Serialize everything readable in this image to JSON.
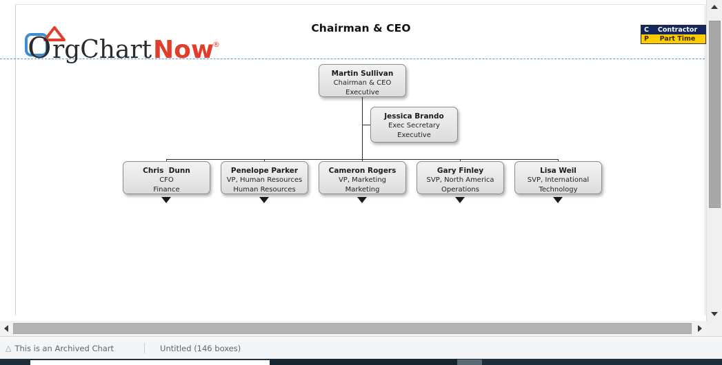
{
  "page_title": "Chairman & CEO",
  "logo": {
    "text_primary": "OrgChart",
    "text_secondary": "Now",
    "trademark": "®",
    "color_primary": "#2b2b2b",
    "color_secondary": "#e03e2d",
    "color_square": "#3f8ed0"
  },
  "legend": {
    "rows": [
      {
        "code": "C",
        "label": "Contractor",
        "bg": "#14265e",
        "fg": "#ffffff"
      },
      {
        "code": "P",
        "label": "Part Time",
        "bg": "#ffcc00",
        "fg": "#3a2a00"
      }
    ]
  },
  "chart_data": {
    "type": "orgchart",
    "title": "Chairman & CEO",
    "root": {
      "name": "Martin Sullivan",
      "title": "Chairman & CEO",
      "department": "Executive"
    },
    "assistant": {
      "name": "Jessica Brando",
      "title": "Exec Secretary",
      "department": "Executive"
    },
    "children": [
      {
        "name": "Chris  Dunn",
        "title": "CFO",
        "department": "Finance",
        "has_children": true
      },
      {
        "name": "Penelope Parker",
        "title": "VP, Human Resources",
        "department": "Human Resources",
        "has_children": true
      },
      {
        "name": "Cameron Rogers",
        "title": "VP, Marketing",
        "department": "Marketing",
        "has_children": true
      },
      {
        "name": "Gary Finley",
        "title": "SVP, North America",
        "department": "Operations",
        "has_children": true
      },
      {
        "name": "Lisa Weil",
        "title": "SVP, International",
        "department": "Technology",
        "has_children": true
      }
    ]
  },
  "statusbar": {
    "archived_text": "This is an Archived Chart",
    "chart_name": "Untitled (146 boxes)"
  },
  "scrollbars": {
    "vertical_up": "scroll-up",
    "vertical_down": "scroll-down",
    "horizontal_left": "scroll-left",
    "horizontal_right": "scroll-right"
  }
}
